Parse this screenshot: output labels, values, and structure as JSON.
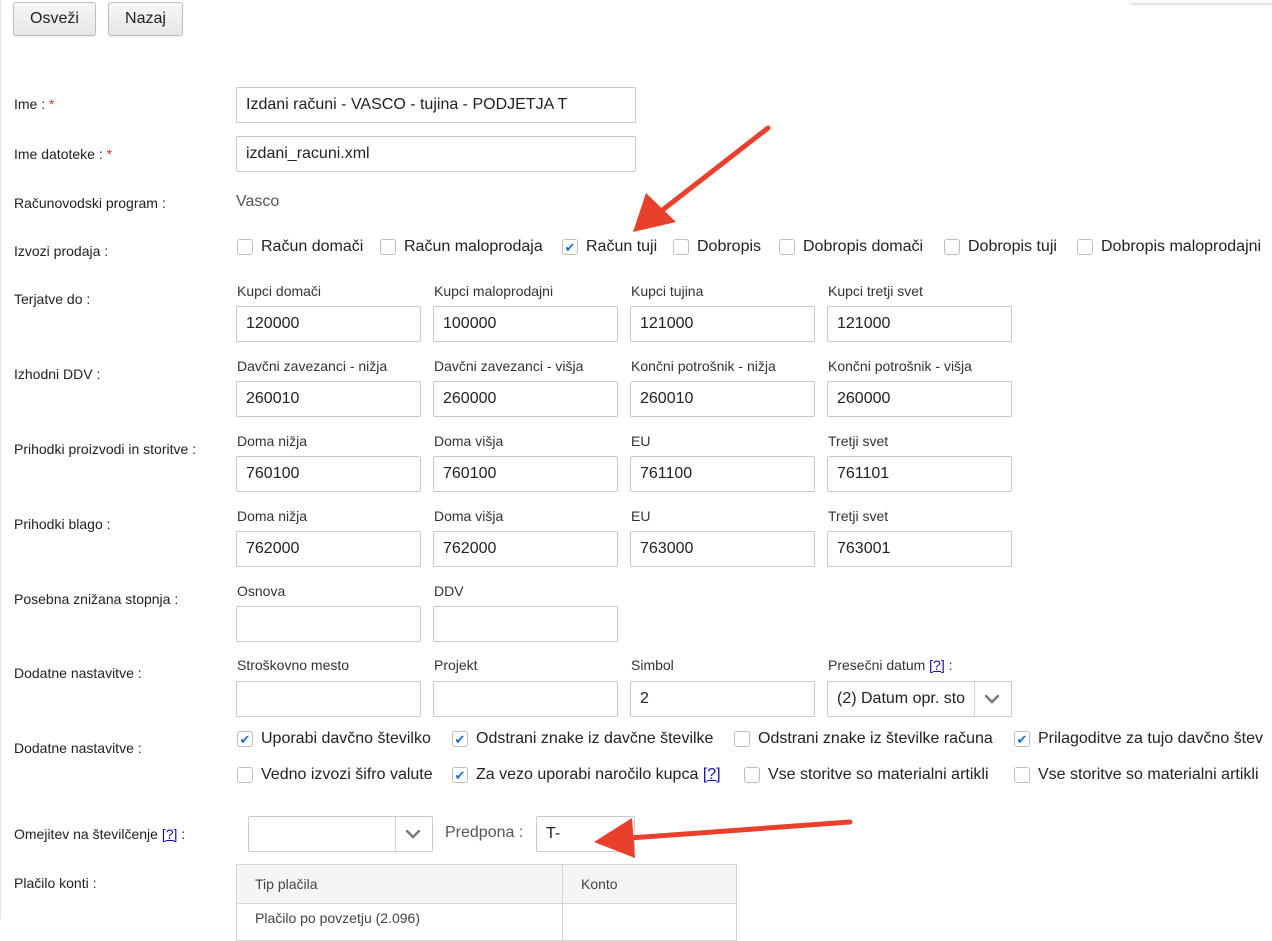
{
  "toolbar": {
    "refresh_label": "Osveži",
    "back_label": "Nazaj"
  },
  "form": {
    "name": {
      "label": "Ime :",
      "required": "*",
      "value": "Izdani računi - VASCO - tujina - PODJETJA T"
    },
    "filename": {
      "label": "Ime datoteke :",
      "required": "*",
      "value": "izdani_racuni.xml"
    },
    "program": {
      "label": "Računovodski program :",
      "value": "Vasco"
    },
    "sales_export": {
      "label": "Izvozi prodaja :",
      "options": [
        {
          "label": "Račun domači",
          "checked": false
        },
        {
          "label": "Račun maloprodaja",
          "checked": false
        },
        {
          "label": "Račun tuji",
          "checked": true
        },
        {
          "label": "Dobropis",
          "checked": false
        },
        {
          "label": "Dobropis domači",
          "checked": false
        },
        {
          "label": "Dobropis tuji",
          "checked": false
        },
        {
          "label": "Dobropis maloprodajni",
          "checked": false
        }
      ]
    },
    "receivables": {
      "label": "Terjatve do :",
      "fields": [
        {
          "label": "Kupci domači",
          "value": "120000"
        },
        {
          "label": "Kupci maloprodajni",
          "value": "100000"
        },
        {
          "label": "Kupci tujina",
          "value": "121000"
        },
        {
          "label": "Kupci tretji svet",
          "value": "121000"
        }
      ]
    },
    "output_vat": {
      "label": "Izhodni DDV :",
      "fields": [
        {
          "label": "Davčni zavezanci - nižja",
          "value": "260010"
        },
        {
          "label": "Davčni zavezanci - višja",
          "value": "260000"
        },
        {
          "label": "Končni potrošnik - nižja",
          "value": "260010"
        },
        {
          "label": "Končni potrošnik - višja",
          "value": "260000"
        }
      ]
    },
    "revenue_products": {
      "label": "Prihodki proizvodi in storitve :",
      "fields": [
        {
          "label": "Doma nižja",
          "value": "760100"
        },
        {
          "label": "Doma višja",
          "value": "760100"
        },
        {
          "label": "EU",
          "value": "761100"
        },
        {
          "label": "Tretji svet",
          "value": "761101"
        }
      ]
    },
    "revenue_goods": {
      "label": "Prihodki blago :",
      "fields": [
        {
          "label": "Doma nižja",
          "value": "762000"
        },
        {
          "label": "Doma višja",
          "value": "762000"
        },
        {
          "label": "EU",
          "value": "763000"
        },
        {
          "label": "Tretji svet",
          "value": "763001"
        }
      ]
    },
    "special_rate": {
      "label": "Posebna znižana stopnja :",
      "fields": [
        {
          "label": "Osnova",
          "value": ""
        },
        {
          "label": "DDV",
          "value": ""
        }
      ]
    },
    "additional_1": {
      "label": "Dodatne nastavitve :",
      "fields": [
        {
          "label": "Stroškovno mesto",
          "value": ""
        },
        {
          "label": "Projekt",
          "value": ""
        },
        {
          "label": "Simbol",
          "value": "2"
        }
      ],
      "cutoff": {
        "label": "Presečni datum",
        "help": "[?]",
        "suffix": ":",
        "selected": "(2) Datum opr. sto"
      }
    },
    "additional_2": {
      "label": "Dodatne nastavitve :",
      "row1": [
        {
          "label": "Uporabi davčno številko",
          "checked": true
        },
        {
          "label": "Odstrani znake iz davčne številke",
          "checked": true
        },
        {
          "label": "Odstrani znake iz številke računa",
          "checked": false
        },
        {
          "label": "Prilagoditve za tujo davčno štev",
          "checked": true
        }
      ],
      "row2": [
        {
          "label": "Vedno izvozi šifro valute",
          "checked": false
        },
        {
          "label": "Za vezo uporabi naročilo kupca",
          "checked": true,
          "help": "[?]"
        },
        {
          "label": "Vse storitve so materialni artikli",
          "checked": false
        },
        {
          "label": "Vse storitve so materialni artikli",
          "checked": false
        }
      ]
    },
    "numbering": {
      "label": "Omejitev na številčenje",
      "help": "[?]",
      "suffix": ":",
      "selected": "",
      "prefix_label": "Predpona :",
      "prefix_value": "T-"
    },
    "payment": {
      "label": "Plačilo konti :",
      "headers": [
        "Tip plačila",
        "Konto"
      ],
      "rows": [
        [
          "Plačilo po povzetju (2.096)",
          ""
        ]
      ]
    }
  },
  "colors": {
    "arrow": "#e8402b",
    "check": "#1e6fc8",
    "required": "#d9372b",
    "link": "#1a0dab"
  }
}
